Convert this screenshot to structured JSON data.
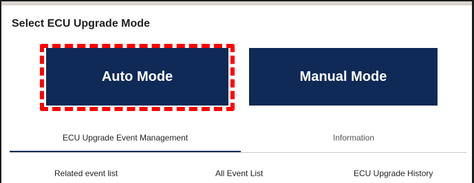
{
  "page": {
    "title": "Select ECU Upgrade Mode"
  },
  "modes": {
    "auto_label": "Auto Mode",
    "manual_label": "Manual Mode"
  },
  "tabs": [
    {
      "label": "ECU Upgrade Event Management",
      "active": true
    },
    {
      "label": "Information",
      "active": false
    }
  ],
  "subtabs": [
    {
      "label": "Related event list"
    },
    {
      "label": "All Event List"
    },
    {
      "label": "ECU Upgrade History"
    }
  ],
  "colors": {
    "primary": "#0f2a57",
    "highlight": "#ff0000"
  }
}
